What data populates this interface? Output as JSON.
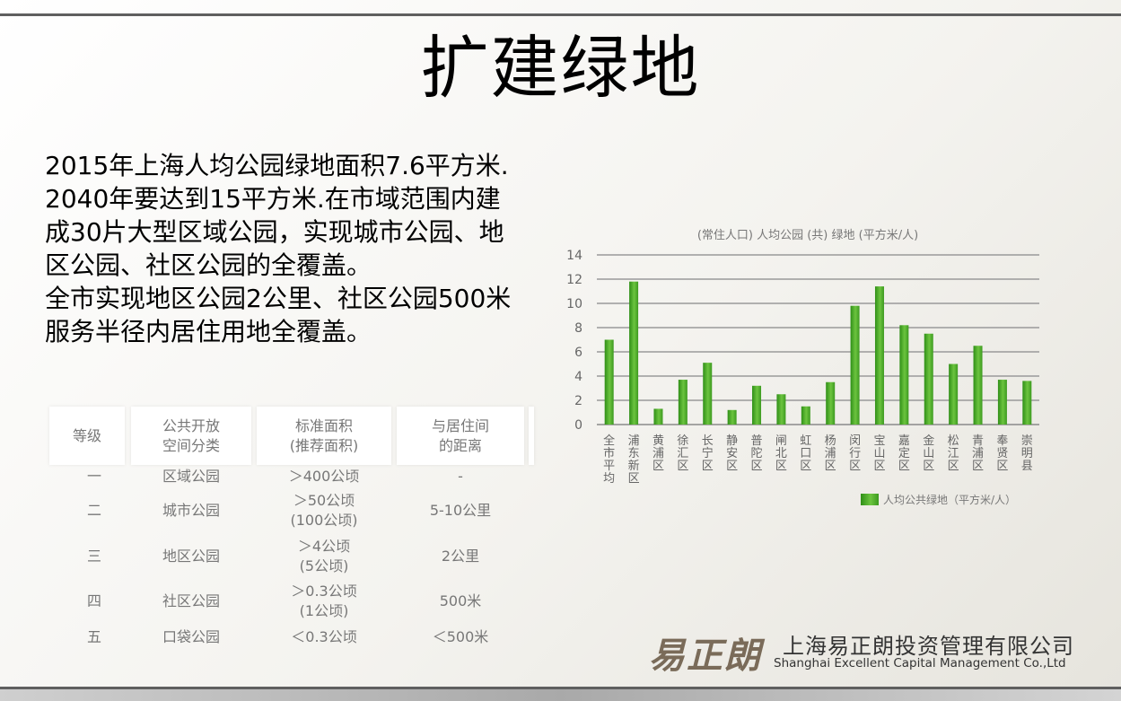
{
  "title": "扩建绿地",
  "body_lines": [
    "2015年上海人均公园绿地面积7.6平方米.",
    "2040年要达到15平方米.在市域范围内建成30片大型区域公园，实现城市公园、地区公园、社区公园的全覆盖。",
    "全市实现地区公园2公里、社区公园500米服务半径内居住用地全覆盖。"
  ],
  "table": {
    "headers": [
      [
        "等级"
      ],
      [
        "公共开放",
        "空间分类"
      ],
      [
        "标准面积",
        "(推荐面积)"
      ],
      [
        "与居住间",
        "的距离"
      ]
    ],
    "rows": [
      {
        "level": "一",
        "type": "区域公园",
        "area": [
          "＞400公顷"
        ],
        "distance": "-"
      },
      {
        "level": "二",
        "type": "城市公园",
        "area": [
          "＞50公顷",
          "(100公顷)"
        ],
        "distance": "5-10公里"
      },
      {
        "level": "三",
        "type": "地区公园",
        "area": [
          "＞4公顷",
          "(5公顷)"
        ],
        "distance": "2公里"
      },
      {
        "level": "四",
        "type": "社区公园",
        "area": [
          "＞0.3公顷",
          "(1公顷)"
        ],
        "distance": "500米"
      },
      {
        "level": "五",
        "type": "口袋公园",
        "area": [
          "＜0.3公顷"
        ],
        "distance": "＜500米"
      }
    ]
  },
  "chart_data": {
    "type": "bar",
    "title": "(常住人口) 人均公园 (共) 绿地 (平方米/人)",
    "xlabel": "",
    "ylabel": "",
    "ylim": [
      0,
      14
    ],
    "yticks": [
      0,
      2,
      4,
      6,
      8,
      10,
      12,
      14
    ],
    "grid": true,
    "legend_position": "bottom-right",
    "categories": [
      "全市平均",
      "浦东新区",
      "黄浦区",
      "徐汇区",
      "长宁区",
      "静安区",
      "普陀区",
      "闸北区",
      "虹口区",
      "杨浦区",
      "闵行区",
      "宝山区",
      "嘉定区",
      "金山区",
      "松江区",
      "青浦区",
      "奉贤区",
      "崇明县"
    ],
    "series": [
      {
        "name": "人均公共绿地（平方米/人）",
        "color": "#4fae2a",
        "values": [
          7.0,
          11.8,
          1.3,
          3.7,
          5.1,
          1.2,
          3.2,
          2.5,
          1.5,
          3.5,
          9.8,
          11.4,
          8.2,
          7.5,
          5.0,
          6.5,
          3.7,
          3.6
        ]
      }
    ]
  },
  "logo": {
    "mark": "易正朗",
    "name_cn": "上海易正朗投资管理有限公司",
    "name_en": "Shanghai Excellent Capital Management Co.,Ltd"
  }
}
